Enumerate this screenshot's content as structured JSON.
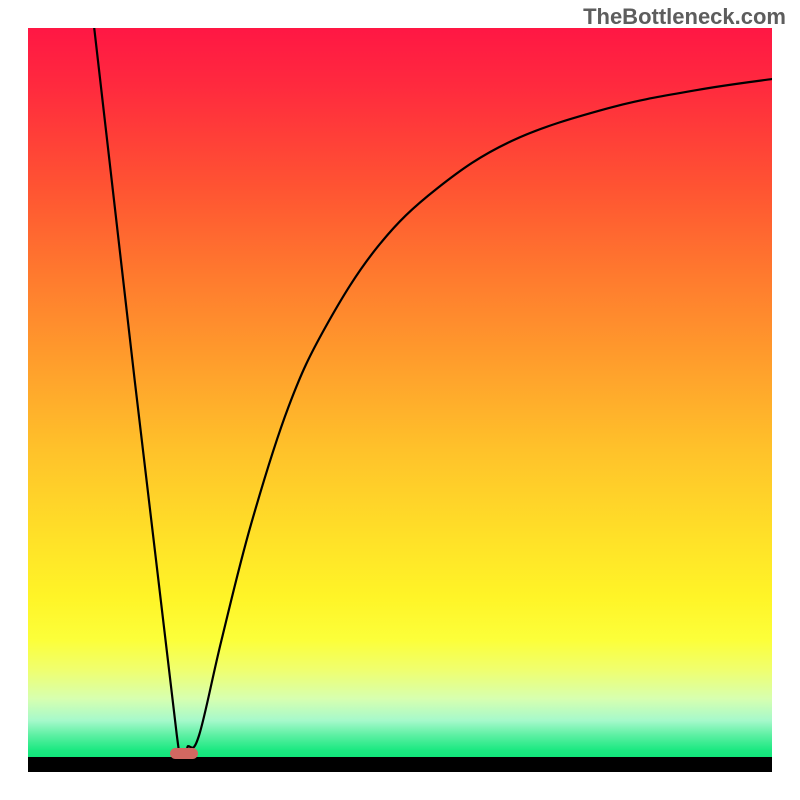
{
  "watermark": "TheBottleneck.com",
  "chart_data": {
    "type": "line",
    "title": "",
    "xlabel": "",
    "ylabel": "",
    "x_range": [
      0,
      100
    ],
    "y_range": [
      0,
      100
    ],
    "marker_x": 21,
    "curve": [
      {
        "x": 8.9,
        "y": 100
      },
      {
        "x": 20.0,
        "y": 3
      },
      {
        "x": 21.5,
        "y": 1.5
      },
      {
        "x": 23.0,
        "y": 3
      },
      {
        "x": 26.0,
        "y": 16
      },
      {
        "x": 30.0,
        "y": 32
      },
      {
        "x": 35.0,
        "y": 48
      },
      {
        "x": 40.0,
        "y": 59
      },
      {
        "x": 47.0,
        "y": 70
      },
      {
        "x": 55.0,
        "y": 78
      },
      {
        "x": 65.0,
        "y": 84.5
      },
      {
        "x": 78.0,
        "y": 89
      },
      {
        "x": 90.0,
        "y": 91.5
      },
      {
        "x": 100.0,
        "y": 93
      }
    ],
    "gradient_stops": [
      {
        "pct": 0,
        "color": "#ff1744"
      },
      {
        "pct": 100,
        "color": "#11e57a"
      }
    ]
  }
}
